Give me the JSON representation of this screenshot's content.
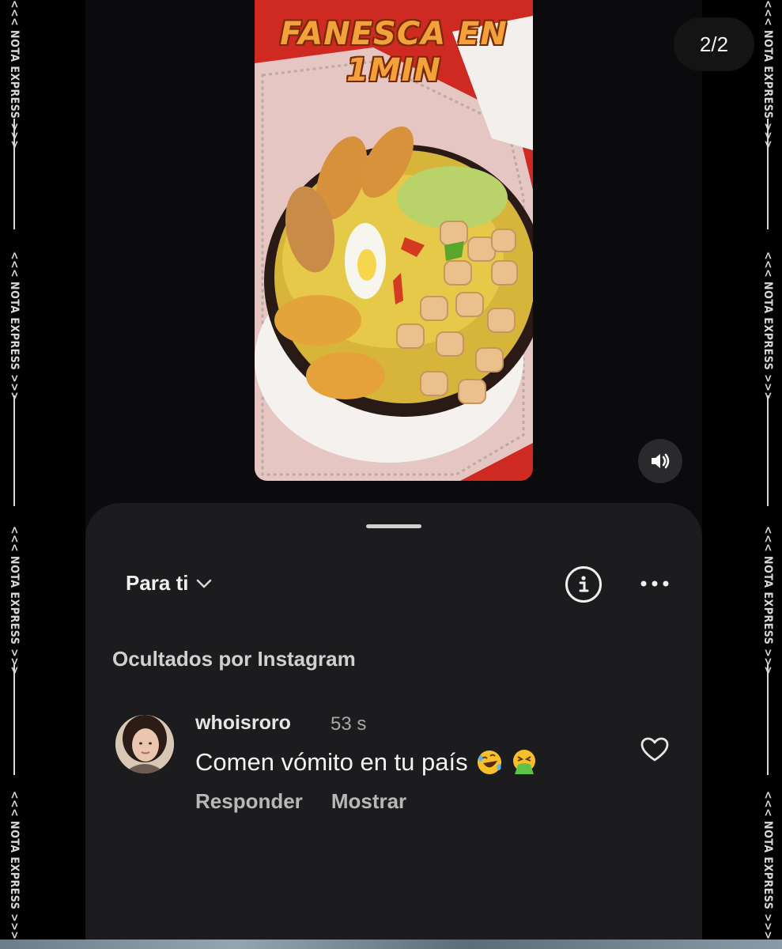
{
  "watermark": {
    "text": "<<< NOTA EXPRESS >>>"
  },
  "page_counter": "2/2",
  "reel": {
    "title_line1": "FANESCA EN",
    "title_line2": "1MIN"
  },
  "mute_icon": "speaker-muted-icon",
  "comments_sheet": {
    "filter_label": "Para ti",
    "filter_icon": "chevron-down-icon",
    "info_icon": "info-icon",
    "more_icon": "more-horizontal-icon",
    "hidden_label": "Ocultados por Instagram",
    "comment": {
      "username": "whoisroro",
      "time": "53 s",
      "text": "Comen vómito en tu país",
      "emojis": [
        "rofl-emoji",
        "vomit-emoji"
      ],
      "reply_label": "Responder",
      "show_label": "Mostrar",
      "like_icon": "heart-outline-icon"
    }
  },
  "colors": {
    "sheet_bg": "#1c1c1e",
    "screen_bg": "#0b0b0d",
    "reel_red": "#d52a23",
    "title_orange": "#f2a13b"
  }
}
